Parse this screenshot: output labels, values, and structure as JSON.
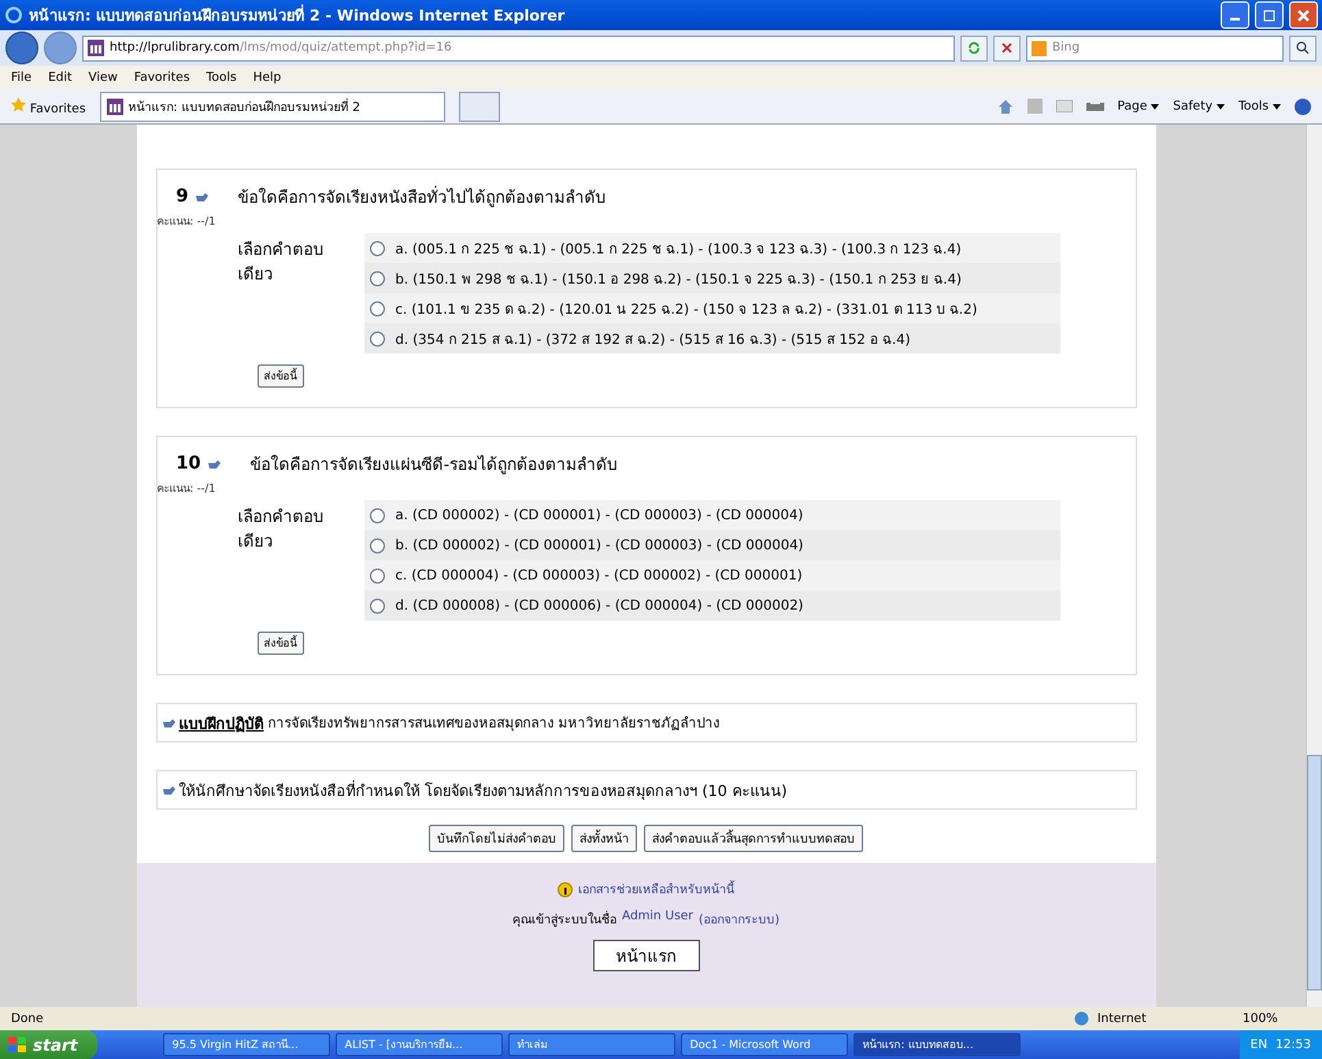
{
  "window": {
    "title": "หน้าแรก: แบบทดสอบก่อนฝึกอบรมหน่วยที่ 2 - Windows Internet Explorer"
  },
  "address": {
    "url_host": "http://lprulibrary.com",
    "url_path": "/lms/mod/quiz/attempt.php?id=16",
    "search_placeholder": "Bing"
  },
  "menu": [
    "File",
    "Edit",
    "View",
    "Favorites",
    "Tools",
    "Help"
  ],
  "favorites": {
    "label": "Favorites",
    "tab": "หน้าแรก: แบบทดสอบก่อนฝึกอบรมหน่วยที่ 2"
  },
  "commands": [
    "Page",
    "Safety",
    "Tools"
  ],
  "questions": [
    {
      "number": "9",
      "text": "ข้อใดคือการจัดเรียงหนังสือทั่วไปได้ถูกต้องตามลำดับ",
      "score": "คะแนน: --/1",
      "prompt": "เลือกคำตอบเดียว",
      "submit": "ส่งข้อนี้",
      "options": [
        {
          "text": "a. (005.1 ก 225 ช ฉ.1) - (005.1 ก 225 ช ฉ.1) - (100.3 จ 123 ฉ.3) - (100.3 ก 123 ฉ.4)",
          "selected": false
        },
        {
          "text": "b. (150.1 พ 298 ช ฉ.1) - (150.1 อ 298 ฉ.2) - (150.1 จ 225 ฉ.3) - (150.1 ก 253 ย ฉ.4)",
          "selected": false
        },
        {
          "text": "c. (101.1 ข 235 ด ฉ.2) - (120.01 น 225 ฉ.2) - (150 จ 123 ล ฉ.2) - (331.01 ต 113 บ ฉ.2)",
          "selected": false
        },
        {
          "text": "d. (354 ก 215 ส ฉ.1) - (372 ส 192 ส ฉ.2) - (515 ส 16 ฉ.3) - (515 ส 152 อ ฉ.4)",
          "selected": false
        }
      ]
    },
    {
      "number": "10",
      "text": "ข้อใดคือการจัดเรียงแผ่นซีดี-รอมได้ถูกต้องตามลำดับ",
      "score": "คะแนน: --/1",
      "prompt": "เลือกคำตอบเดียว",
      "submit": "ส่งข้อนี้",
      "options": [
        {
          "text": "a. (CD 000002) - (CD 000001) - (CD 000003) - (CD 000004)",
          "selected": false
        },
        {
          "text": "b. (CD 000002) - (CD 000001) - (CD 000003) - (CD 000004)",
          "selected": false
        },
        {
          "text": "c. (CD 000004) - (CD 000003) - (CD 000002) - (CD 000001)",
          "selected": false
        },
        {
          "text": "d. (CD 000008) - (CD 000006) - (CD 000004) - (CD 000002)",
          "selected": false
        }
      ]
    }
  ],
  "sections": [
    {
      "link": "แบบฝึกปฏิบัติ",
      "text": "การจัดเรียงทรัพยากรสารสนเทศของหอสมุดกลาง มหาวิทยาลัยราชภัฏลำปาง"
    },
    {
      "text": "ให้นักศึกษาจัดเรียงหนังสือที่กำหนดให้ โดยจัดเรียงตามหลักการของหอสมุดกลางฯ (10 คะแนน)"
    }
  ],
  "buttons": [
    "บันทึกโดยไม่ส่งคำตอบ",
    "ส่งทั้งหน้า",
    "ส่งคำตอบแล้วสิ้นสุดการทำแบบทดสอบ"
  ],
  "footer": {
    "help": "เอกสารช่วยเหลือสำหรับหน้านี้",
    "login_prefix": "คุณเข้าสู่ระบบในชื่อ",
    "user": "Admin User",
    "logout": "(ออกจากระบบ)",
    "home": "หน้าแรก"
  },
  "status": {
    "text": "Done",
    "zone": "Internet",
    "zoom": "100%"
  },
  "taskbar": {
    "start": "start",
    "tasks": [
      {
        "label": "95.5 Virgin HitZ สถานี...",
        "selected": false
      },
      {
        "label": "ALIST - [งานบริการยืม...",
        "selected": false
      },
      {
        "label": "ทำเล่ม",
        "selected": false
      },
      {
        "label": "Doc1 - Microsoft Word",
        "selected": false
      },
      {
        "label": "หน้าแรก: แบบทดสอบ...",
        "selected": true
      }
    ],
    "lang": "EN",
    "clock": "12:53"
  }
}
